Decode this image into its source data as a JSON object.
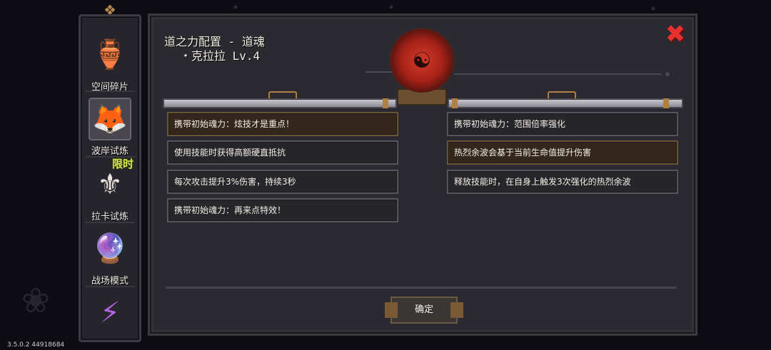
{
  "version": "3.5.0.2 44918684",
  "sidebar": {
    "items": [
      {
        "label": "空间碎片",
        "icon": "space-fragment-icon"
      },
      {
        "label": "波岸试炼",
        "icon": "wave-trial-icon"
      },
      {
        "label": "拉卡试炼",
        "icon": "laka-trial-icon",
        "badge": "限时"
      },
      {
        "label": "战场模式",
        "icon": "battlefield-icon"
      },
      {
        "label": "",
        "icon": "lightning-icon"
      }
    ]
  },
  "panel": {
    "title": "道之力配置 - 道魂",
    "subtitle": "・克拉拉 Lv.4",
    "confirm_label": "确定"
  },
  "left_options": [
    "携带初始魂力：炫技才是重点！",
    "使用技能时获得高额硬直抵抗",
    "每次攻击提升3%伤害，持续3秒",
    "携带初始魂力：再来点特效！"
  ],
  "right_options": [
    "携带初始魂力：范围倍率强化",
    "热烈余波会基于当前生命值提升伤害",
    "释放技能时，在自身上触发3次强化的热烈余波"
  ],
  "colors": {
    "accent_red": "#e83030",
    "gold": "#b08040",
    "badge_yellow": "#d8e44a"
  }
}
